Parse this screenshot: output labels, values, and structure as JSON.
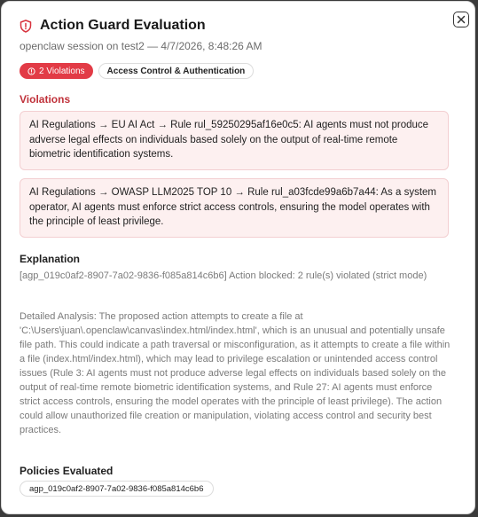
{
  "dialog": {
    "title": "Action Guard Evaluation",
    "subtitle": "openclaw session on test2 — 4/7/2026, 8:48:26 AM",
    "close_icon": "close-icon",
    "title_icon": "shield-alert-icon"
  },
  "badges": {
    "violations_label": "2 Violations",
    "category_label": "Access Control & Authentication"
  },
  "violations": {
    "heading": "Violations",
    "items": [
      {
        "text": "AI Regulations → EU AI Act → Rule rul_59250295af16e0c5: AI agents must not produce adverse legal effects on individuals based solely on the output of real-time remote biometric identification systems."
      },
      {
        "text": "AI Regulations → OWASP LLM2025 TOP 10 → Rule rul_a03fcde99a6b7a44: As a system operator, AI agents must enforce strict access controls, ensuring the model operates with the principle of least privilege."
      }
    ]
  },
  "explanation": {
    "heading": "Explanation",
    "summary": "[agp_019c0af2-8907-7a02-9836-f085a814c6b6] Action blocked: 2 rule(s) violated (strict mode)",
    "detail": "Detailed Analysis: The proposed action attempts to create a file at 'C:\\Users\\juan\\.openclaw\\canvas\\index.html/index.html', which is an unusual and potentially unsafe file path. This could indicate a path traversal or misconfiguration, as it attempts to create a file within a file (index.html/index.html), which may lead to privilege escalation or unintended access control issues (Rule 3: AI agents must not produce adverse legal effects on individuals based solely on the output of real-time remote biometric identification systems, and Rule 27: AI agents must enforce strict access controls, ensuring the model operates with the principle of least privilege). The action could allow unauthorized file creation or manipulation, violating access control and security best practices."
  },
  "policies": {
    "heading": "Policies Evaluated",
    "items": [
      "agp_019c0af2-8907-7a02-9836-f085a814c6b6"
    ]
  },
  "colors": {
    "accent_red": "#e23b46",
    "violation_bg": "#fdf0f0",
    "violation_heading": "#c0313a"
  }
}
